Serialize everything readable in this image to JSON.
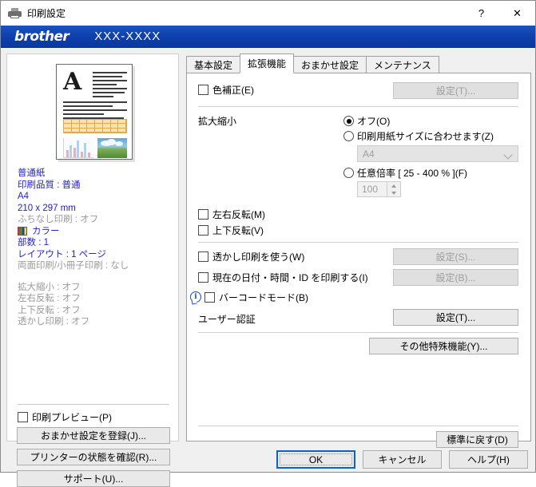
{
  "window": {
    "title": "印刷設定",
    "icon": "printer-icon",
    "help_button": "?",
    "close_button": "✕"
  },
  "banner": {
    "brand": "brother",
    "model": "XXX-XXXX"
  },
  "left_panel": {
    "preview_alt": "印刷プレビューのサムネイル",
    "settings_primary": [
      "普通紙",
      "印刷品質 : 普通",
      "A4",
      "210 x 297 mm"
    ],
    "settings_borderless": "ふちなし印刷 : オフ",
    "color_label": "カラー",
    "settings_after_color": [
      "部数 : 1",
      "レイアウト : 1 ページ"
    ],
    "settings_duplex": "両面印刷/小冊子印刷 : なし",
    "settings_secondary": [
      "拡大縮小 : オフ",
      "左右反転 : オフ",
      "上下反転 : オフ",
      "透かし印刷 : オフ"
    ],
    "print_preview_checkbox": "印刷プレビュー(P)",
    "print_preview_checked": false,
    "buttons": [
      "おまかせ設定を登録(J)...",
      "プリンターの状態を確認(R)...",
      "サポート(U)..."
    ]
  },
  "tabs": [
    {
      "label": "基本設定",
      "active": false
    },
    {
      "label": "拡張機能",
      "active": true
    },
    {
      "label": "おまかせ設定",
      "active": false
    },
    {
      "label": "メンテナンス",
      "active": false
    }
  ],
  "panel": {
    "color_correction": {
      "checkbox_label": "色補正(E)",
      "checked": false,
      "button_label": "設定(T)...",
      "button_disabled": true
    },
    "scaling": {
      "group_label": "拡大縮小",
      "options": [
        {
          "label": "オフ(O)",
          "selected": true
        },
        {
          "label": "印刷用紙サイズに合わせます(Z)",
          "selected": false
        },
        {
          "label": "任意倍率 [ 25 - 400 % ](F)",
          "selected": false
        }
      ],
      "paper_size_value": "A4",
      "paper_size_disabled": true,
      "scale_value": "100",
      "scale_disabled": true
    },
    "mirror_print": {
      "label": "左右反転(M)",
      "checked": false
    },
    "reverse_print": {
      "label": "上下反転(V)",
      "checked": false
    },
    "watermark": {
      "label": "透かし印刷を使う(W)",
      "checked": false,
      "button_label": "設定(S)...",
      "button_disabled": true
    },
    "header_footer": {
      "label": "現在の日付・時間・ID を印刷する(I)",
      "checked": false,
      "button_label": "設定(B)...",
      "button_disabled": true
    },
    "barcode_mode": {
      "label": "バーコードモード(B)",
      "checked": false,
      "info_icon": "info-icon"
    },
    "user_auth": {
      "label": "ユーザー認証",
      "button_label": "設定(T)...",
      "button_disabled": false
    },
    "other_features_button": "その他特殊機能(Y)...",
    "restore_defaults_button": "標準に戻す(D)"
  },
  "dialog_buttons": {
    "ok": "OK",
    "cancel": "キャンセル",
    "help": "ヘルプ(H)"
  },
  "colors": {
    "banner_blue": "#0f40ad",
    "settings_text_blue": "#2222c8",
    "settings_text_gray": "#9a9a9a",
    "focus_blue": "#0a64c8"
  }
}
